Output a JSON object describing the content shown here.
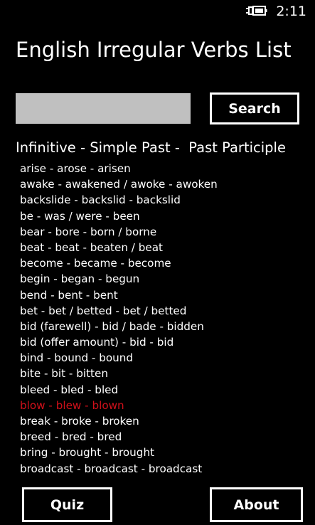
{
  "status_bar": {
    "time": "2:11",
    "battery_icon": "battery-charging-icon"
  },
  "app": {
    "title": "English Irregular Verbs List"
  },
  "search": {
    "value": "",
    "button_label": "Search"
  },
  "list_header": "Infinitive - Simple Past -  Past Participle",
  "verbs": [
    "arise - arose - arisen",
    "awake - awakened / awoke - awoken",
    "backslide - backslid - backslid",
    "be - was / were - been",
    "bear - bore - born / borne",
    "beat - beat - beaten / beat",
    "become - became - become",
    "begin - began - begun",
    "bend - bent - bent",
    "bet - bet / betted - bet / betted",
    "bid (farewell) - bid / bade - bidden",
    "bid (offer amount) - bid - bid",
    "bind - bound - bound",
    "bite - bit - bitten",
    "bleed - bled - bled",
    "blow - blew - blown",
    "break - broke - broken",
    "breed - bred - bred",
    "bring - brought - brought",
    "broadcast - broadcast - broadcast"
  ],
  "highlighted_verb": "blow - blew - blown",
  "footer": {
    "quiz_label": "Quiz",
    "about_label": "About"
  },
  "colors": {
    "background": "#000000",
    "text": "#ffffff",
    "highlight": "#d0101a",
    "search_field": "#c0c0c0"
  }
}
